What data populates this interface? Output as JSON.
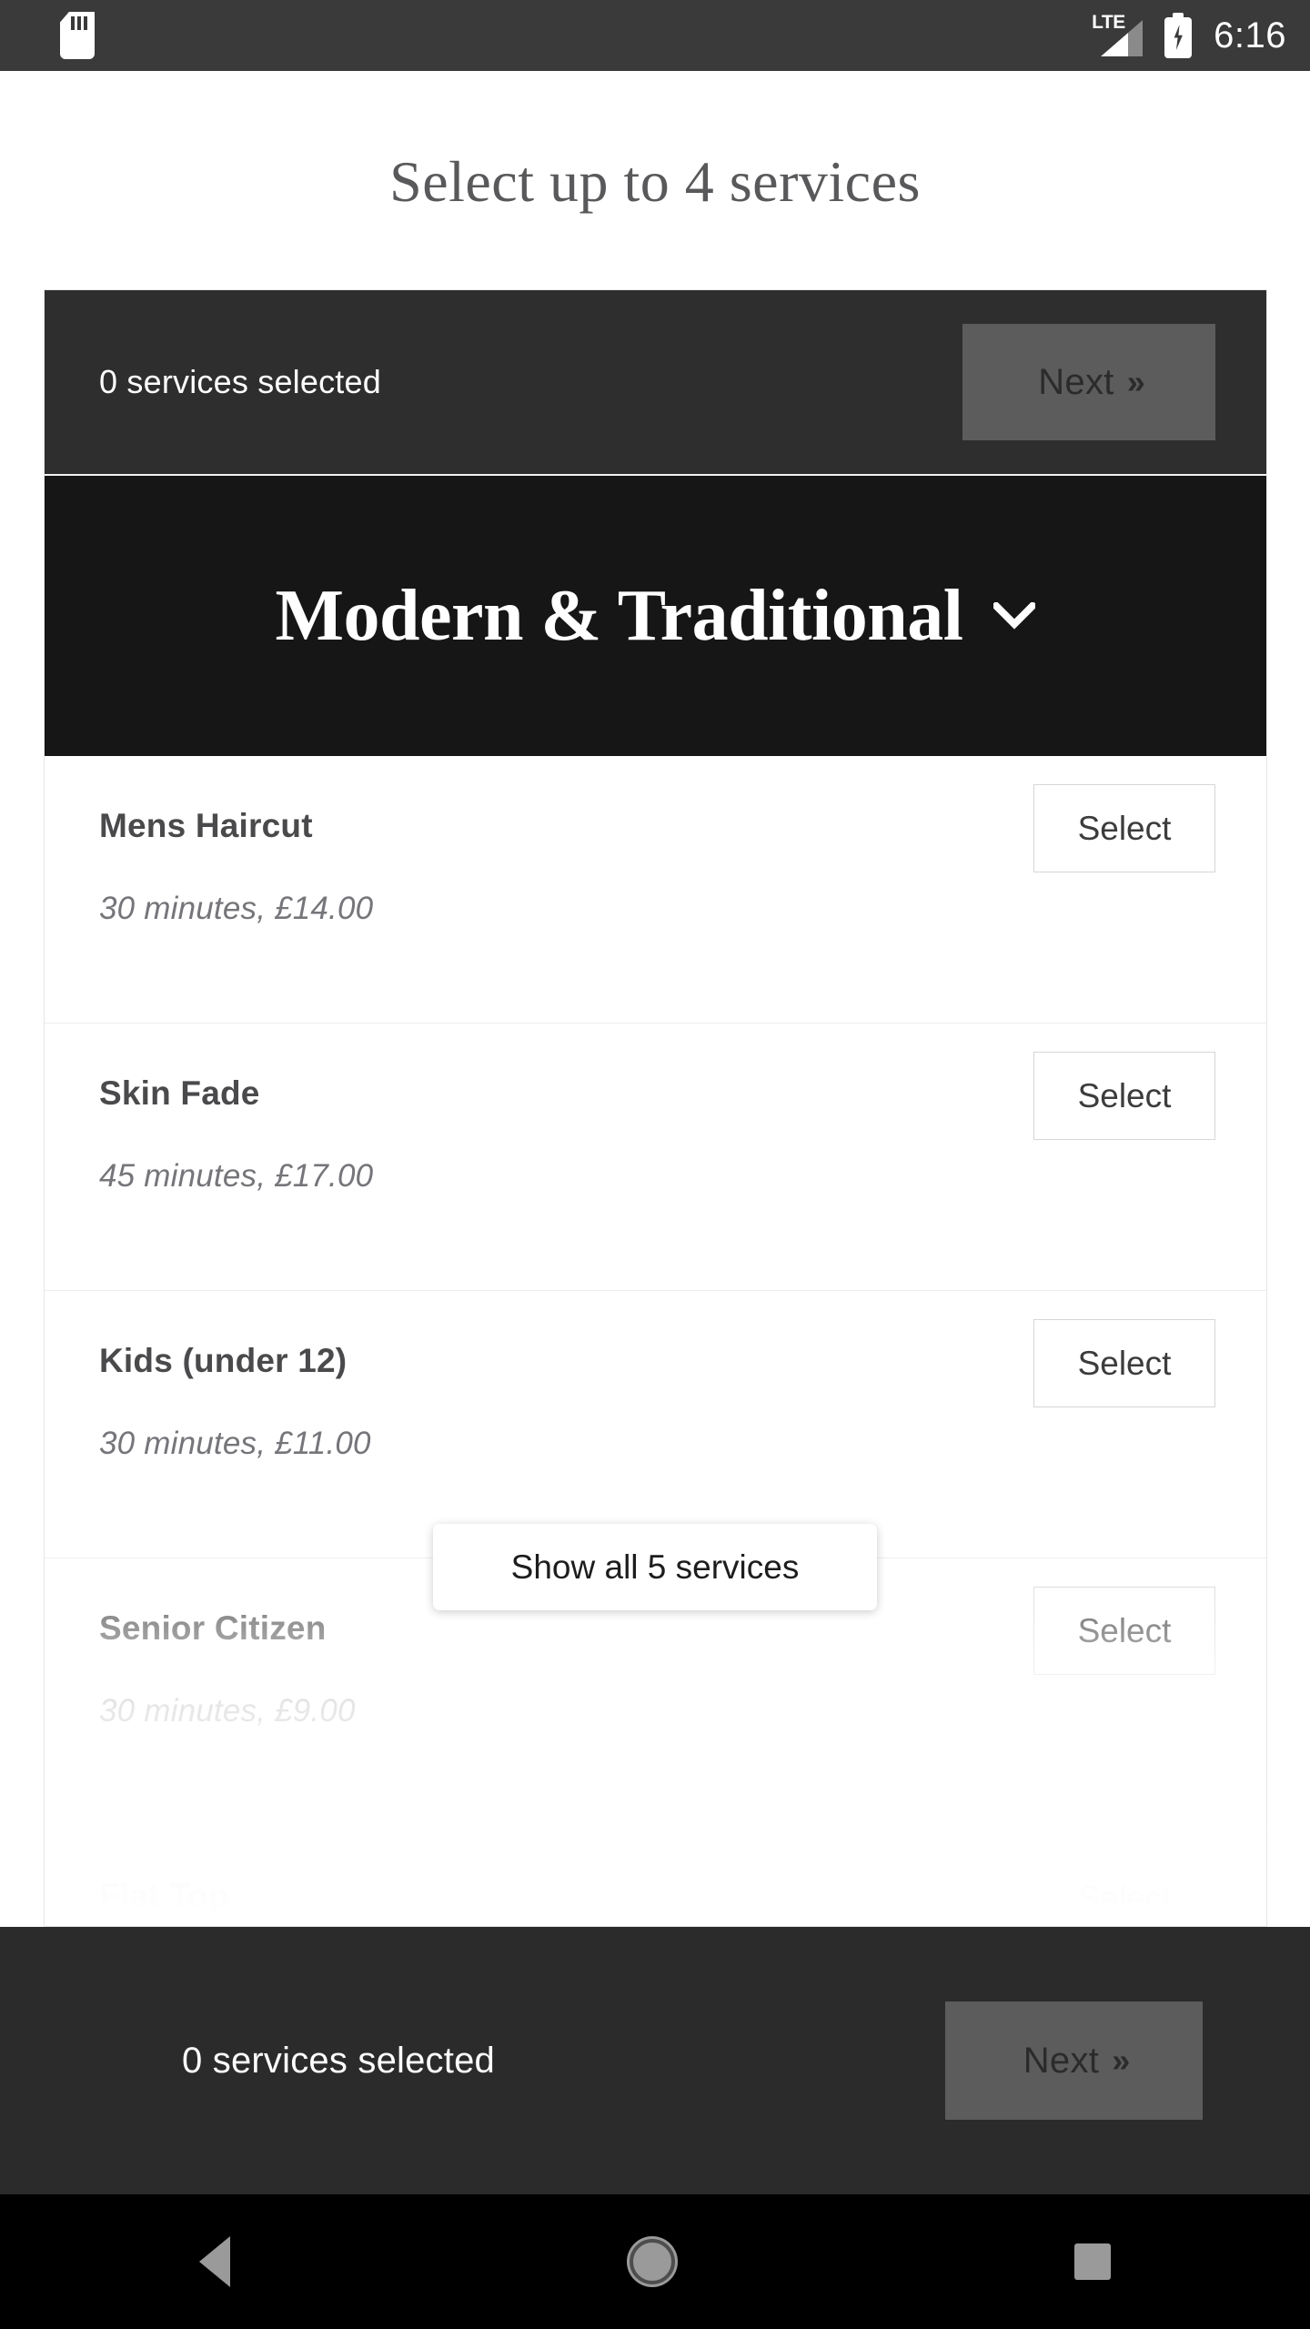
{
  "status_bar": {
    "sd_card_icon": "sd-card-icon",
    "network_label": "LTE",
    "signal_icon": "signal-bars-icon",
    "battery_icon": "battery-charging-icon",
    "time": "6:16"
  },
  "page": {
    "title": "Select up to 4 services",
    "max_services": 4
  },
  "summary_top": {
    "text": "0 services selected",
    "next_label": "Next",
    "next_chevrons": "»",
    "next_disabled": true
  },
  "category": {
    "name": "Modern & Traditional",
    "expand_icon": "chevron-down-icon",
    "expanded": true
  },
  "services": [
    {
      "name": "Mens Haircut",
      "meta": "30 minutes, £14.00",
      "duration": "30 minutes",
      "price": "£14.00",
      "select_label": "Select"
    },
    {
      "name": "Skin Fade",
      "meta": "45 minutes, £17.00",
      "duration": "45 minutes",
      "price": "£17.00",
      "select_label": "Select"
    },
    {
      "name": "Kids (under 12)",
      "meta": "30 minutes, £11.00",
      "duration": "30 minutes",
      "price": "£11.00",
      "select_label": "Select"
    },
    {
      "name": "Senior Citizen",
      "meta": "30 minutes, £9.00",
      "duration": "30 minutes",
      "price": "£9.00",
      "select_label": "Select"
    },
    {
      "name": "Flat Top",
      "meta": "",
      "duration": "",
      "price": "",
      "select_label": "Select"
    }
  ],
  "show_all": {
    "label": "Show all 5 services",
    "total_services": 5
  },
  "summary_bottom": {
    "text": "0 services selected",
    "next_label": "Next",
    "next_chevrons": "»",
    "next_disabled": true
  },
  "nav_bar": {
    "back_icon": "back-triangle-icon",
    "home_icon": "home-circle-icon",
    "recents_icon": "recents-square-icon"
  },
  "colors": {
    "summary_bar_bg": "#2e2e2e",
    "category_bg": "#161616",
    "bottom_bar_bg": "#2b2b2b",
    "next_disabled_bg": "#5c5c5c",
    "title_text": "#59595b",
    "service_name": "#4a4a4c",
    "service_meta": "#75757a",
    "border": "#e6e6e6"
  }
}
